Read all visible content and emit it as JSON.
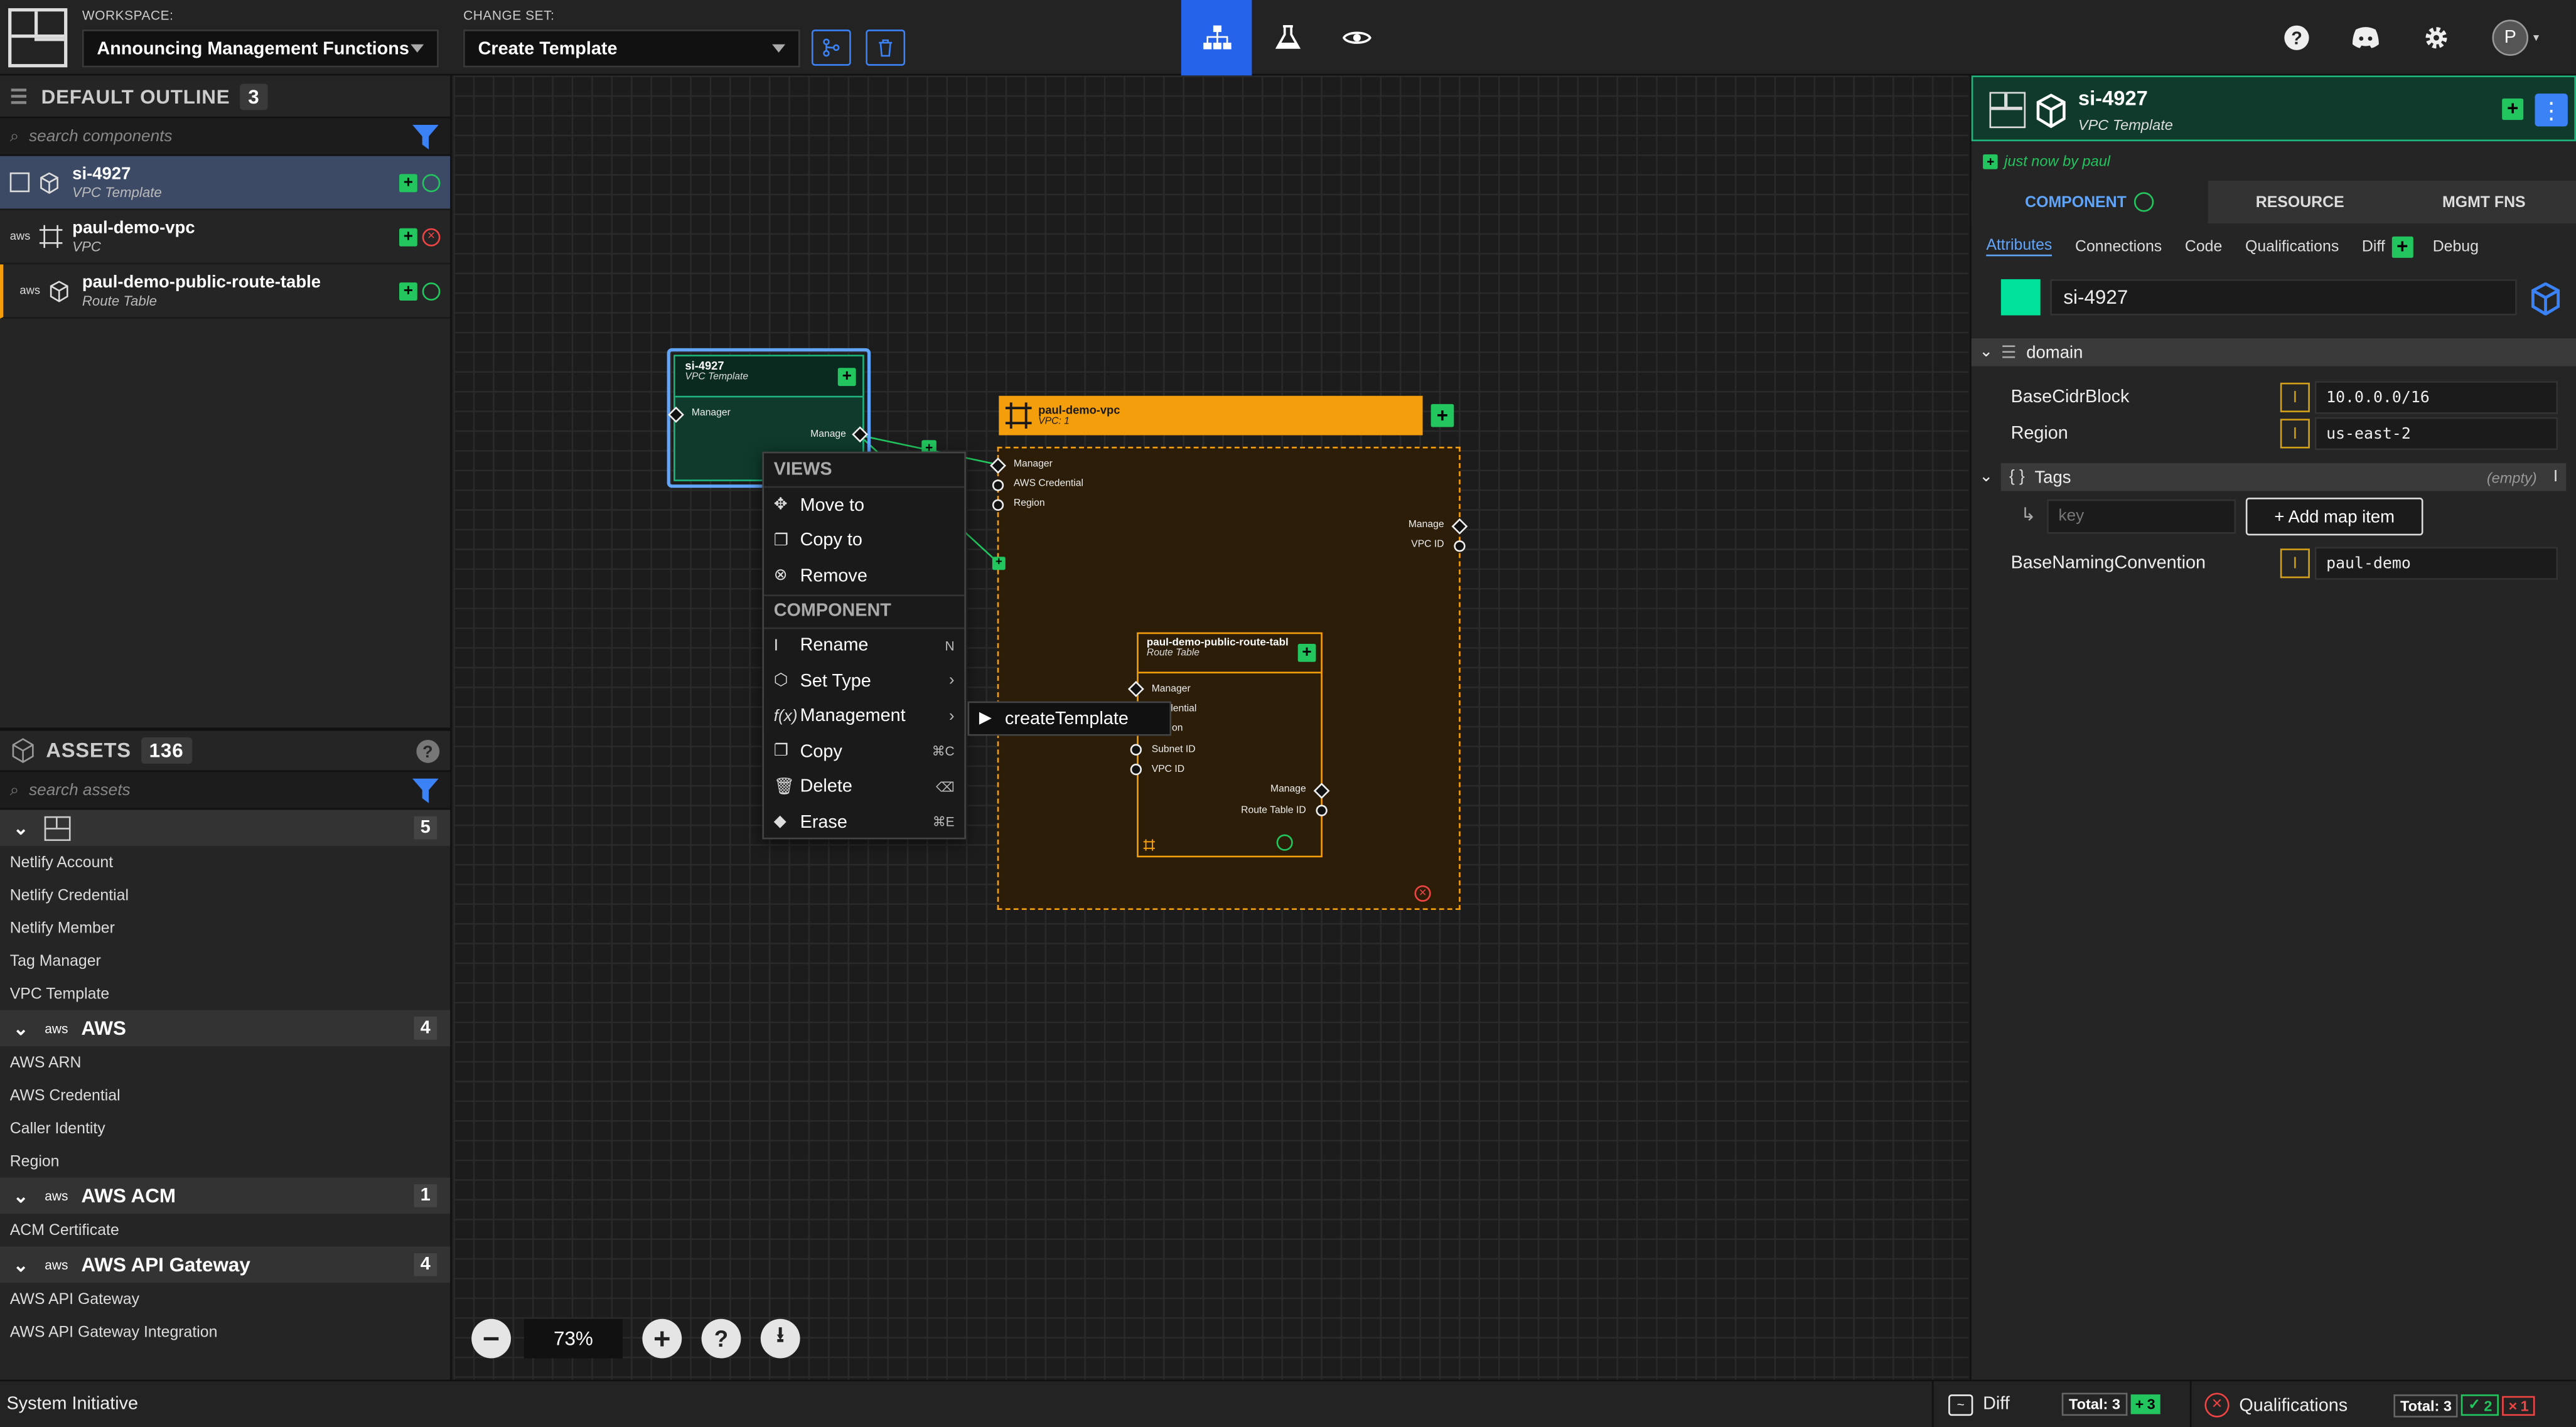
{
  "header": {
    "workspace_label": "WORKSPACE:",
    "workspace_value": "Announcing Management Functions",
    "changeset_label": "CHANGE SET:",
    "changeset_value": "Create Template",
    "avatar_letter": "P",
    "accent": "#3b82f6"
  },
  "outline": {
    "title": "DEFAULT OUTLINE",
    "count": "3",
    "search_placeholder": "search components",
    "items": [
      {
        "name": "si-4927",
        "type": "VPC Template"
      },
      {
        "name": "paul-demo-vpc",
        "type": "VPC"
      },
      {
        "name": "paul-demo-public-route-table",
        "type": "Route Table"
      }
    ]
  },
  "assets": {
    "title": "ASSETS",
    "count": "136",
    "search_placeholder": "search assets",
    "categories": [
      {
        "name": "",
        "count": "5",
        "items": [
          "Netlify Account",
          "Netlify Credential",
          "Netlify Member",
          "Tag Manager",
          "VPC Template"
        ]
      },
      {
        "name": "AWS",
        "count": "4",
        "items": [
          "AWS ARN",
          "AWS Credential",
          "Caller Identity",
          "Region"
        ]
      },
      {
        "name": "AWS ACM",
        "count": "1",
        "items": [
          "ACM Certificate"
        ]
      },
      {
        "name": "AWS API Gateway",
        "count": "4",
        "items": [
          "AWS API Gateway",
          "AWS API Gateway Integration"
        ]
      }
    ]
  },
  "canvas": {
    "zoom": "73%",
    "template_node": {
      "name": "si-4927",
      "type": "VPC Template",
      "socket_in": "Manager",
      "socket_out": "Manage"
    },
    "vpc_node": {
      "name": "paul-demo-vpc",
      "type": "VPC: 1",
      "sockets_in": [
        "Manager",
        "AWS Credential",
        "Region"
      ],
      "sockets_out": [
        "Manage",
        "VPC ID"
      ]
    },
    "rt_node": {
      "name": "paul-demo-public-route-table",
      "type": "Route Table",
      "sockets_in": [
        "Manager",
        "Credential",
        "Region",
        "Subnet ID",
        "VPC ID"
      ],
      "sockets_out": [
        "Manage",
        "Route Table ID"
      ]
    }
  },
  "context_menu": {
    "views_header": "VIEWS",
    "views": [
      {
        "label": "Move to"
      },
      {
        "label": "Copy to"
      },
      {
        "label": "Remove"
      }
    ],
    "component_header": "COMPONENT",
    "component": [
      {
        "label": "Rename",
        "shortcut": "N"
      },
      {
        "label": "Set Type",
        "shortcut": ""
      },
      {
        "label": "Management",
        "shortcut": ""
      },
      {
        "label": "Copy",
        "shortcut": "⌘C"
      },
      {
        "label": "Delete",
        "shortcut": "⌫"
      },
      {
        "label": "Erase",
        "shortcut": "⌘E"
      }
    ],
    "submenu_item": "createTemplate"
  },
  "details": {
    "name": "si-4927",
    "type": "VPC Template",
    "updated": "just now by paul",
    "tabs": [
      "COMPONENT",
      "RESOURCE",
      "MGMT FNS"
    ],
    "subtabs": [
      "Attributes",
      "Connections",
      "Code",
      "Qualifications",
      "Diff",
      "Debug"
    ],
    "component_color": "#00e19a",
    "name_field": "si-4927",
    "domain_label": "domain",
    "attrs": [
      {
        "label": "BaseCidrBlock",
        "value": "10.0.0.0/16"
      },
      {
        "label": "Region",
        "value": "us-east-2"
      }
    ],
    "tags_label": "Tags",
    "tags_empty": "(empty)",
    "key_placeholder": "key",
    "add_map_item": "+ Add map item",
    "naming_label": "BaseNamingConvention",
    "naming_value": "paul-demo"
  },
  "status": {
    "app_name": "System Initiative",
    "diff_label": "Diff",
    "diff_total": "Total: 3",
    "diff_added": "3",
    "qual_label": "Qualifications",
    "qual_total": "Total: 3",
    "qual_ok": "2",
    "qual_fail": "1"
  }
}
